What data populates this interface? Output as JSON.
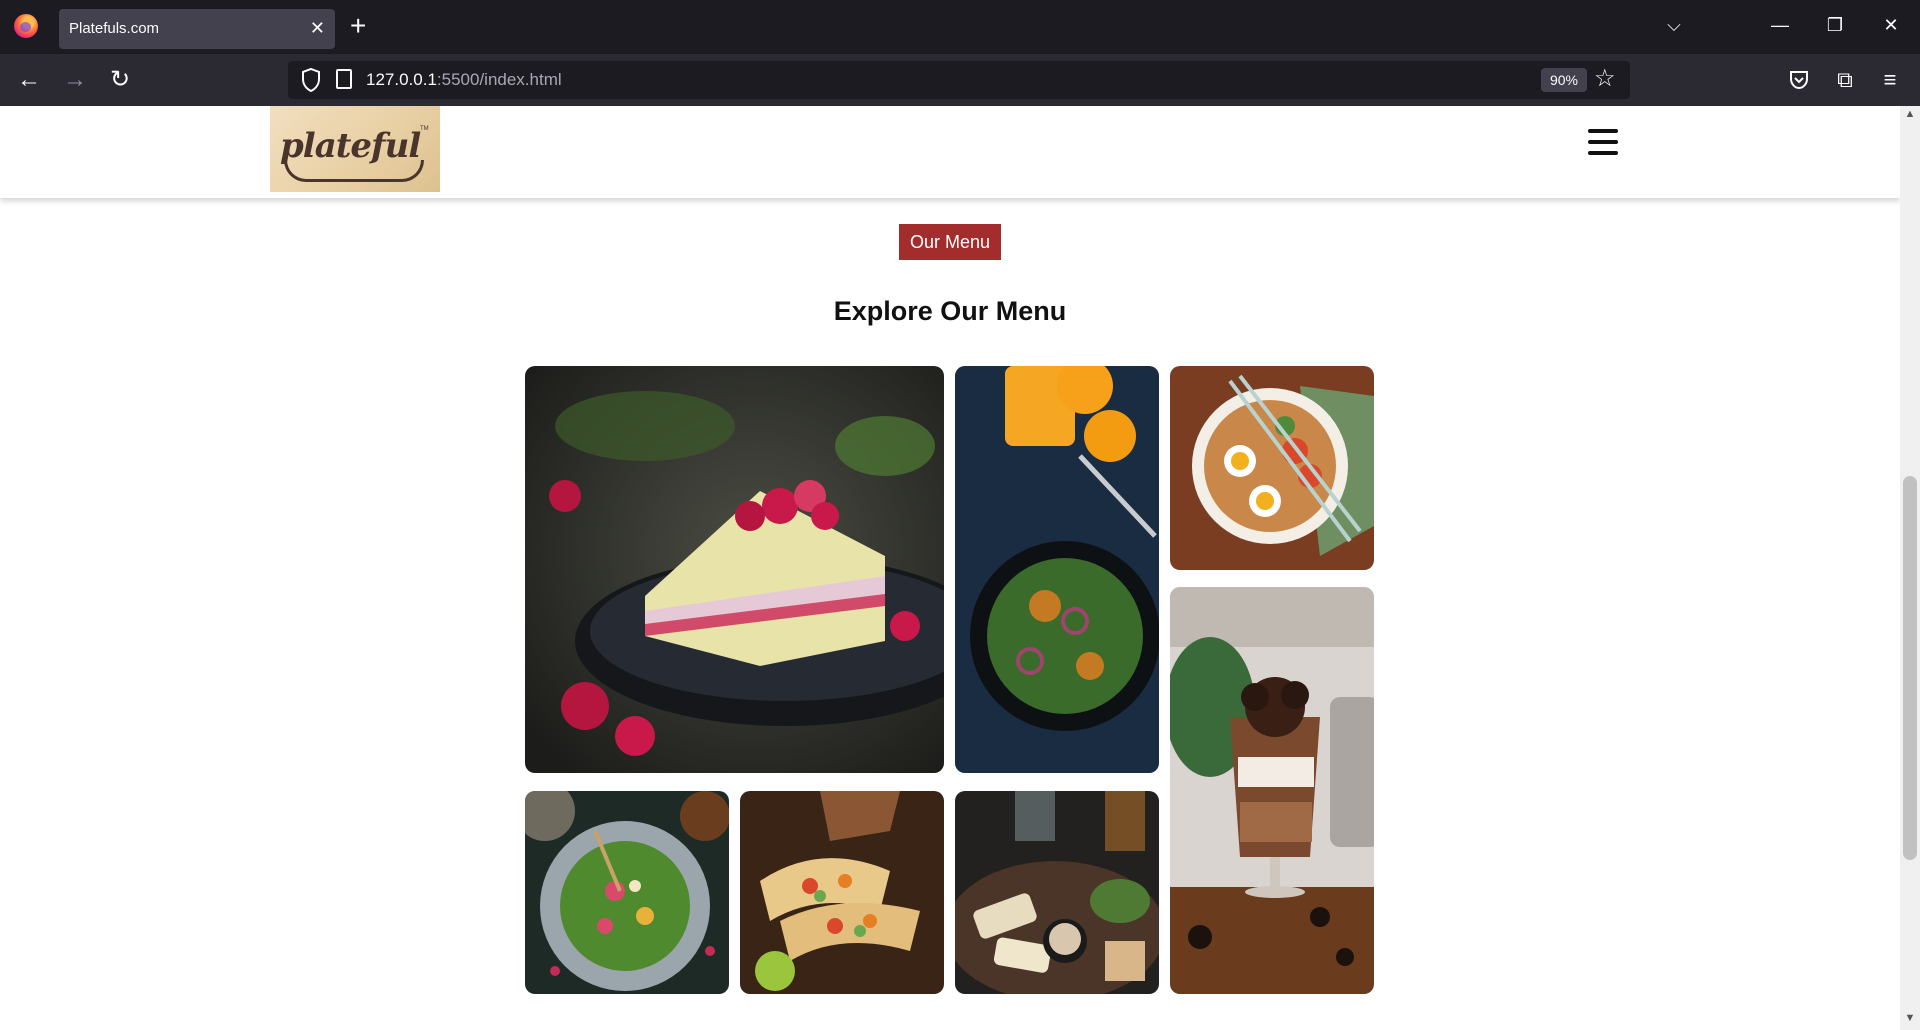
{
  "browser": {
    "tab_title": "Platefuls.com",
    "tab_close": "✕",
    "new_tab": "+",
    "url_host": "127.0.0.1",
    "url_path": ":5500/index.html",
    "zoom": "90%",
    "icons": [
      "firefox-logo",
      "back-arrow",
      "forward-arrow",
      "reload",
      "shield",
      "page",
      "star",
      "pocket",
      "extensions",
      "menu"
    ]
  },
  "header": {
    "logo_text": "plateful",
    "logo_tm": "TM"
  },
  "menu_section": {
    "badge_label": "Our Menu",
    "title": "Explore Our Menu",
    "accent_color": "#a32d2d",
    "images": [
      {
        "name": "raspberry-cake"
      },
      {
        "name": "salad-with-orange-juice"
      },
      {
        "name": "ramen-bowl"
      },
      {
        "name": "oreo-chocolate-sundae"
      },
      {
        "name": "herb-salad-plate"
      },
      {
        "name": "tacos"
      },
      {
        "name": "grilled-halloumi-plate"
      }
    ]
  }
}
